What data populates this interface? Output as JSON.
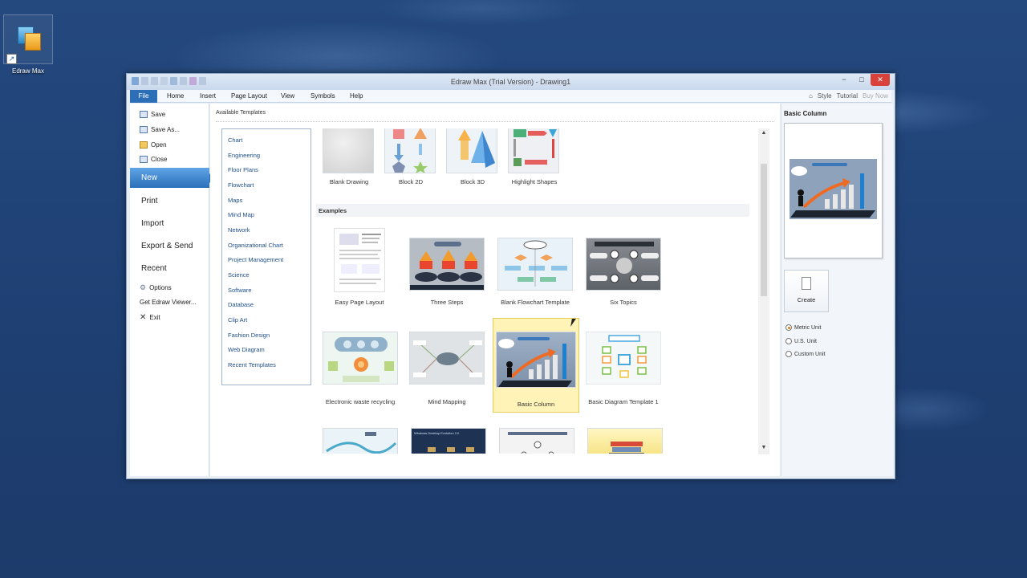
{
  "desktop": {
    "icon_label": "Edraw Max"
  },
  "window": {
    "title": "Edraw Max (Trial Version) - Drawing1",
    "controls": {
      "minimize": "−",
      "restore": "□",
      "close": "✕"
    }
  },
  "menubar": {
    "file": "File",
    "items": [
      "Home",
      "Insert",
      "Page Layout",
      "View",
      "Symbols",
      "Help"
    ],
    "right": {
      "style": "Style",
      "tutorial": "Tutorial",
      "buy_now": "Buy Now"
    }
  },
  "backstage": {
    "small_items": [
      "Save",
      "Save As...",
      "Open",
      "Close"
    ],
    "new": "New",
    "big_items": [
      "Print",
      "Import",
      "Export & Send",
      "Recent"
    ],
    "bottom_items": [
      "Options",
      "Get Edraw Viewer...",
      "Exit"
    ]
  },
  "content": {
    "available_templates": "Available Templates",
    "categories": [
      "Chart",
      "Engineering",
      "Floor Plans",
      "Flowchart",
      "Maps",
      "Mind Map",
      "Network",
      "Organizational Chart",
      "Project Management",
      "Science",
      "Software",
      "Database",
      "Clip Art",
      "Fashion Design",
      "Web Diagram",
      "Recent Templates"
    ],
    "top_templates": [
      "Blank Drawing",
      "Block 2D",
      "Block 3D",
      "Highlight Shapes"
    ],
    "examples_header": "Examples",
    "examples_row1": [
      "Easy Page Layout",
      "Three Steps",
      "Blank Flowchart Template",
      "Six Topics"
    ],
    "examples_row2": [
      "Electronic waste recycling",
      "Mind Mapping",
      "Basic Column",
      "Basic Diagram Template 1"
    ],
    "row3_banner": "Windows Desktop Evolution 2.0"
  },
  "rightpanel": {
    "title": "Basic Column",
    "create": "Create",
    "units": [
      "Metric Unit",
      "U.S. Unit",
      "Custom Unit"
    ],
    "selected_unit": "Metric Unit"
  },
  "colors": {
    "accent": "#2d6fb6",
    "selection": "#fff3b8",
    "desktop": "#1f4479"
  }
}
